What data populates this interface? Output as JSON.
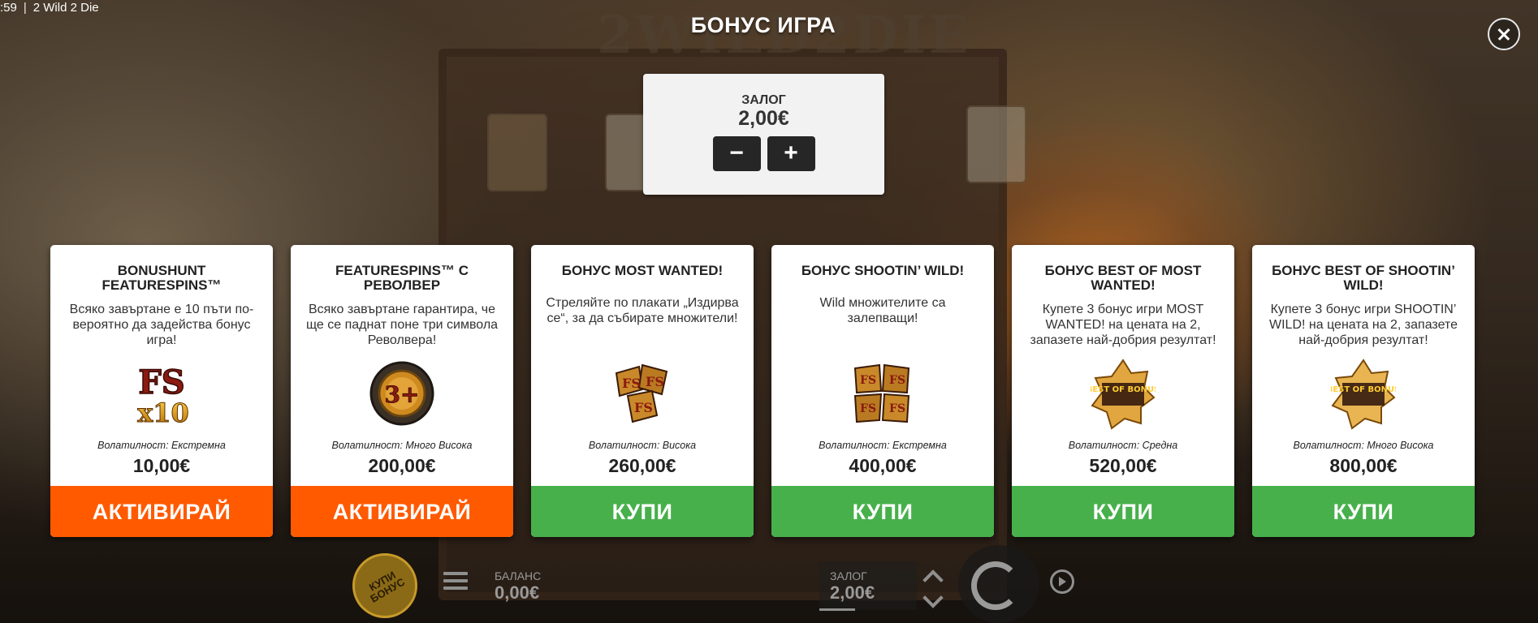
{
  "top_bar": {
    "time": ":59",
    "separator": "|",
    "game_title": "2 Wild 2 Die"
  },
  "background": {
    "logo_text": "2WILD2DIE"
  },
  "dialog": {
    "title": "БОНУС ИГРА",
    "close_icon": "close-icon"
  },
  "bet": {
    "label": "ЗАЛОГ",
    "value": "2,00€",
    "decrease_label": "−",
    "increase_label": "+"
  },
  "cards": [
    {
      "title": "BONUSHUNT FEATURESPINS™",
      "description": "Всяко завъртане е 10 пъти по-вероятно да задейства бонус игра!",
      "icon": "fs-x10-icon",
      "volatility": "Волатилност: Екстремна",
      "price": "10,00€",
      "button_label": "АКТИВИРАЙ",
      "button_color": "#ff5a00"
    },
    {
      "title": "FEATURESPINS™ С РЕВОЛВЕР",
      "description": "Всяко завъртане гарантира, че ще се паднат поне три символа Револвера!",
      "icon": "revolver-3plus-icon",
      "volatility": "Волатилност: Много Висока",
      "price": "200,00€",
      "button_label": "АКТИВИРАЙ",
      "button_color": "#ff5a00"
    },
    {
      "title": "БОНУС MOST WANTED!",
      "description": "Стреляйте по плакати „Издирва се“, за да събирате множители!",
      "icon": "most-wanted-icon",
      "volatility": "Волатилност: Висока",
      "price": "260,00€",
      "button_label": "КУПИ",
      "button_color": "#47b04b"
    },
    {
      "title": "БОНУС SHOOTIN’ WILD!",
      "description": "Wild множителите са залепващи!",
      "icon": "shootin-wild-icon",
      "volatility": "Волатилност: Екстремна",
      "price": "400,00€",
      "button_label": "КУПИ",
      "button_color": "#47b04b"
    },
    {
      "title": "БОНУС BEST OF MOST WANTED!",
      "description": "Купете 3 бонус игри MOST WANTED! на цената на 2, запазете най-добрия резултат!",
      "icon": "best-of-bonus-icon",
      "icon_text": "BEST OF BONUS",
      "volatility": "Волатилност: Средна",
      "price": "520,00€",
      "button_label": "КУПИ",
      "button_color": "#47b04b"
    },
    {
      "title": "БОНУС BEST OF SHOOTIN’ WILD!",
      "description": "Купете 3 бонус игри SHOOTIN’ WILD! на цената на 2, запазете най-добрия резултат!",
      "icon": "best-of-bonus-icon",
      "icon_text": "BEST OF BONUS",
      "volatility": "Волатилност: Много Висока",
      "price": "800,00€",
      "button_label": "КУПИ",
      "button_color": "#47b04b"
    }
  ],
  "bottom_bar": {
    "buy_bonus_label": "КУПИ БОНУС",
    "balance_label": "БАЛАНС",
    "balance_value": "0,00€",
    "bet_label": "ЗАЛОГ",
    "bet_value": "2,00€"
  },
  "colors": {
    "activate": "#ff5a00",
    "buy": "#47b04b",
    "panel": "#f2f2f2"
  }
}
